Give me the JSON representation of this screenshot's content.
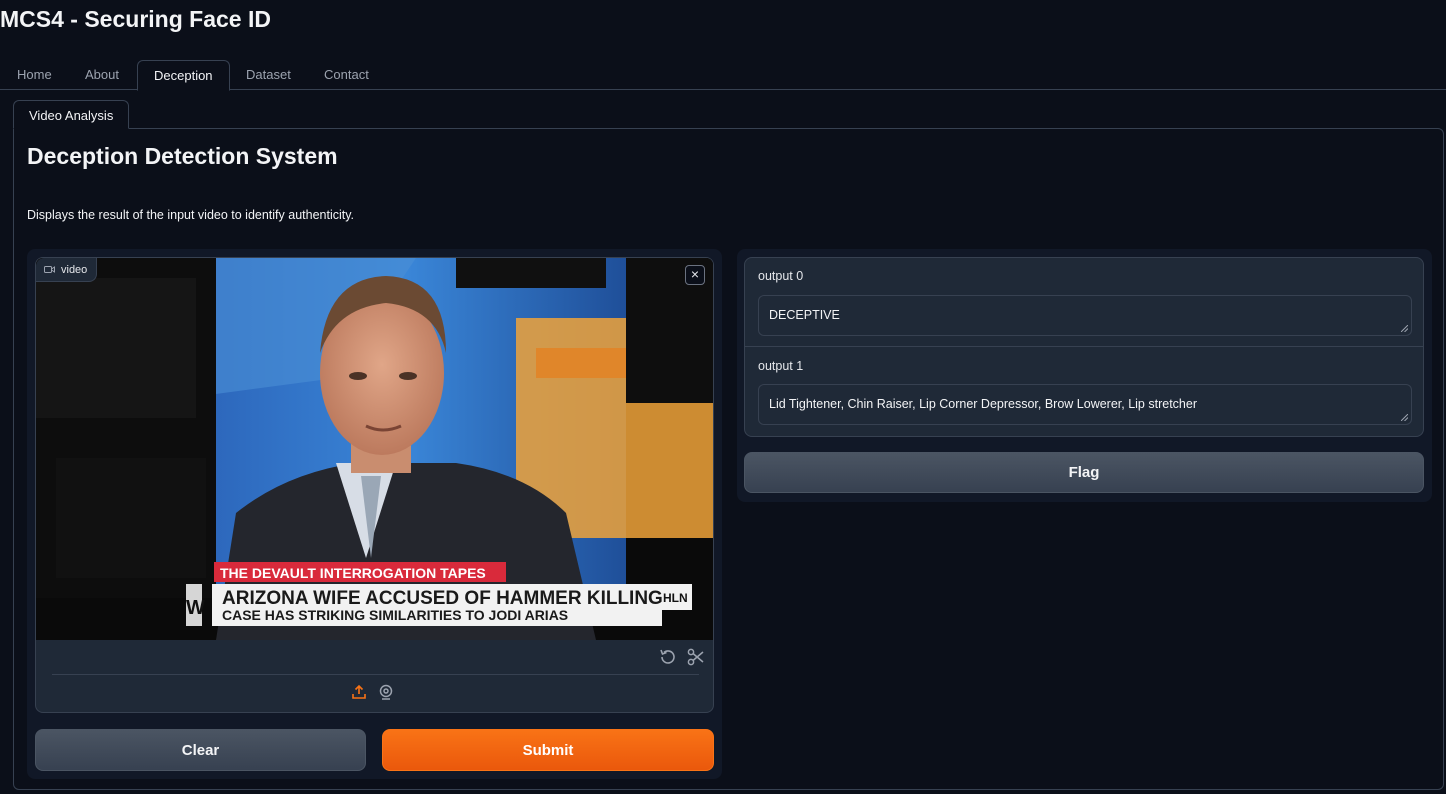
{
  "app": {
    "title": "MCS4 - Securing Face ID"
  },
  "tabs": [
    {
      "label": "Home",
      "active": false
    },
    {
      "label": "About",
      "active": false
    },
    {
      "label": "Deception",
      "active": true
    },
    {
      "label": "Dataset",
      "active": false
    },
    {
      "label": "Contact",
      "active": false
    }
  ],
  "subtab": {
    "label": "Video Analysis"
  },
  "section": {
    "title": "Deception Detection System",
    "description": "Displays the result of the input video to identify authenticity."
  },
  "video": {
    "label": "video",
    "label_icon": "video-camera-icon",
    "close_icon": "close-icon",
    "close_symbol": "×",
    "controls": [
      "undo-icon",
      "scissors-icon"
    ],
    "sources": [
      "upload-icon",
      "webcam-icon"
    ],
    "frame": {
      "tag": "THE DEVAULT INTERROGATION TAPES",
      "headline": "ARIZONA WIFE ACCUSED OF HAMMER KILLING",
      "subheadline": "CASE HAS STRIKING SIMILARITIES TO JODI ARIAS",
      "network": "HLN",
      "side_letter": "W"
    }
  },
  "buttons": {
    "clear": "Clear",
    "submit": "Submit",
    "flag": "Flag"
  },
  "outputs": [
    {
      "label": "output 0",
      "value": "DECEPTIVE"
    },
    {
      "label": "output 1",
      "value": "Lid Tightener, Chin Raiser, Lip Corner Depressor, Brow Lowerer, Lip stretcher"
    }
  ],
  "colors": {
    "background": "#0b0f19",
    "panel": "#111827",
    "block": "#1f2937",
    "border": "#374151",
    "accent": "#f97316"
  }
}
